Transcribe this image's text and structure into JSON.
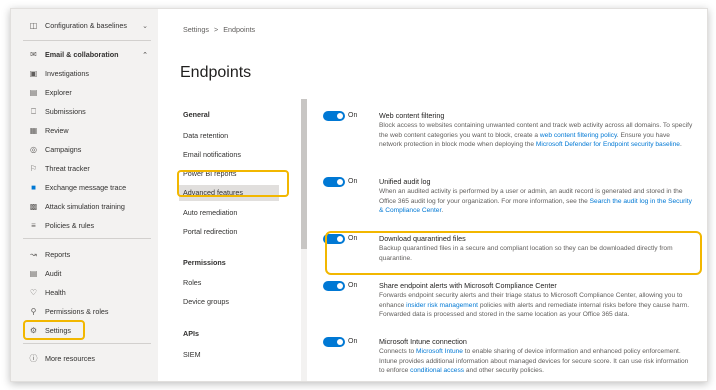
{
  "nav": {
    "items": [
      {
        "icon": "config-icon",
        "label": "Configuration & baselines",
        "chevron": "⌄"
      },
      {
        "icon": "mail-icon",
        "label": "Email & collaboration",
        "chevron": "⌃"
      },
      {
        "icon": "investigations-icon",
        "label": "Investigations"
      },
      {
        "icon": "explorer-icon",
        "label": "Explorer"
      },
      {
        "icon": "submissions-icon",
        "label": "Submissions"
      },
      {
        "icon": "review-icon",
        "label": "Review"
      },
      {
        "icon": "campaigns-icon",
        "label": "Campaigns"
      },
      {
        "icon": "threat-tracker-icon",
        "label": "Threat tracker"
      },
      {
        "icon": "exchange-icon",
        "label": "Exchange message trace"
      },
      {
        "icon": "attack-sim-icon",
        "label": "Attack simulation training"
      },
      {
        "icon": "policies-icon",
        "label": "Policies & rules"
      },
      {
        "icon": "reports-icon",
        "label": "Reports"
      },
      {
        "icon": "audit-icon",
        "label": "Audit"
      },
      {
        "icon": "health-icon",
        "label": "Health"
      },
      {
        "icon": "permissions-icon",
        "label": "Permissions & roles"
      },
      {
        "icon": "gear-icon",
        "label": "Settings"
      },
      {
        "icon": "more-icon",
        "label": "More resources"
      }
    ]
  },
  "breadcrumb": {
    "root": "Settings",
    "separator": ">",
    "current": "Endpoints"
  },
  "page_title": "Endpoints",
  "subnav": {
    "general_heading": "General",
    "general_items": [
      "Data retention",
      "Email notifications",
      "Power BI reports",
      "Advanced features",
      "Auto remediation",
      "Portal redirection"
    ],
    "permissions_heading": "Permissions",
    "permissions_items": [
      "Roles",
      "Device groups"
    ],
    "apis_heading": "APIs",
    "apis_items": [
      "SIEM"
    ]
  },
  "features": [
    {
      "toggle": "On",
      "title": "Web content filtering",
      "desc_1": "Block access to websites containing unwanted content and track web activity across all domains. To specify the web content categories you want to block, create a ",
      "link_1": "web content filtering policy",
      "desc_2": ". Ensure you have network protection in block mode when deploying the ",
      "link_2": "Microsoft Defender for Endpoint security baseline",
      "desc_3": "."
    },
    {
      "toggle": "On",
      "title": "Unified audit log",
      "desc_1": "When an audited activity is performed by a user or admin, an audit record is generated and stored in the Office 365 audit log for your organization. For more information, see the ",
      "link_1": "Search the audit log in the Security & Compliance Center",
      "desc_2": "."
    },
    {
      "toggle": "On",
      "title": "Download quarantined files",
      "desc_1": "Backup quarantined files in a secure and compliant location so they can be downloaded directly from quarantine."
    },
    {
      "toggle": "On",
      "title": "Share endpoint alerts with Microsoft Compliance Center",
      "desc_1": "Forwards endpoint security alerts and their triage status to Microsoft Compliance Center, allowing you to enhance ",
      "link_1": "insider risk management",
      "desc_2": " policies with alerts and remediate internal risks before they cause harm. Forwarded data is processed and stored in the same location as your Office 365 data."
    },
    {
      "toggle": "On",
      "title": "Microsoft Intune connection",
      "desc_1": "Connects to ",
      "link_1": "Microsoft Intune",
      "desc_2": " to enable sharing of device information and enhanced policy enforcement. Intune provides additional information about managed devices for secure score. It can use risk information to enforce ",
      "link_2": "conditional access",
      "desc_3": " and other security policies."
    }
  ],
  "colors": {
    "accent": "#0078d4",
    "highlight": "#f2b700",
    "nav_bg": "#f3f2f1"
  }
}
